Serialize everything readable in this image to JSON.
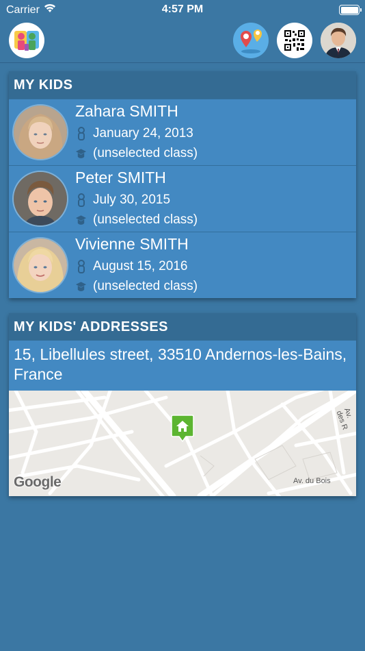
{
  "status_bar": {
    "carrier": "Carrier",
    "time": "4:57 PM"
  },
  "nav": {
    "logo_icon": "kids-app-logo-icon",
    "map_icon": "map-pins-icon",
    "qr_icon": "qr-code-icon",
    "profile_icon": "parent-avatar"
  },
  "kids_section": {
    "title": "MY KIDS",
    "kids": [
      {
        "name": "Zahara SMITH",
        "birthdate": "January 24, 2013",
        "class": "(unselected class)"
      },
      {
        "name": "Peter SMITH",
        "birthdate": "July 30, 2015",
        "class": "(unselected class)"
      },
      {
        "name": "Vivienne SMITH",
        "birthdate": "August 15, 2016",
        "class": "(unselected class)"
      }
    ]
  },
  "address_section": {
    "title": "MY KIDS' ADDRESSES",
    "address": "15, Libellules street, 33510 Andernos-les-Bains, France",
    "map": {
      "provider": "Google",
      "street_labels": [
        "Av. du Bois",
        "Av. des R"
      ],
      "marker_icon": "home-marker-icon"
    }
  },
  "colors": {
    "background": "#3b77a3",
    "header": "#346b93",
    "row": "#4389c2",
    "marker": "#5cb531"
  }
}
